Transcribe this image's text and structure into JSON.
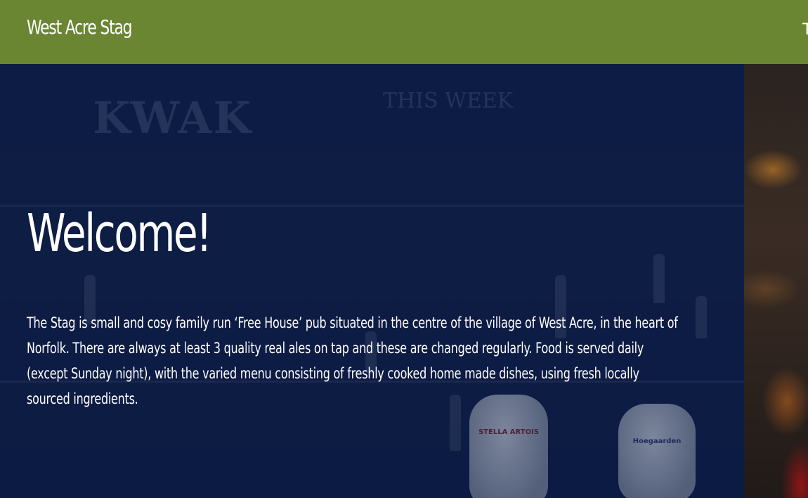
{
  "header": {
    "site_title": "West Acre Stag",
    "nav_fragment": "T",
    "background_color": "#6a8632"
  },
  "hero": {
    "heading": "Welcome!",
    "intro_text": "The Stag is small and cosy family run ‘Free House’ pub situated in the centre of the village of West Acre, in the heart of Norfolk. There are always at least 3 quality real ales on tap and these are changed regularly. Food is served daily (except Sunday night), with the varied menu consisting of freshly cooked home made dishes, using fresh locally sourced ingredients.",
    "overlay_color": "#0a1c48",
    "background_image": "blurred-bar-with-beer-taps",
    "background_signage": {
      "sign_brand": "KWAK",
      "chalkboard_line_1": "THIS WEEK",
      "tap_1": "STELLA ARTOIS",
      "tap_2": "Hoegaarden"
    }
  }
}
